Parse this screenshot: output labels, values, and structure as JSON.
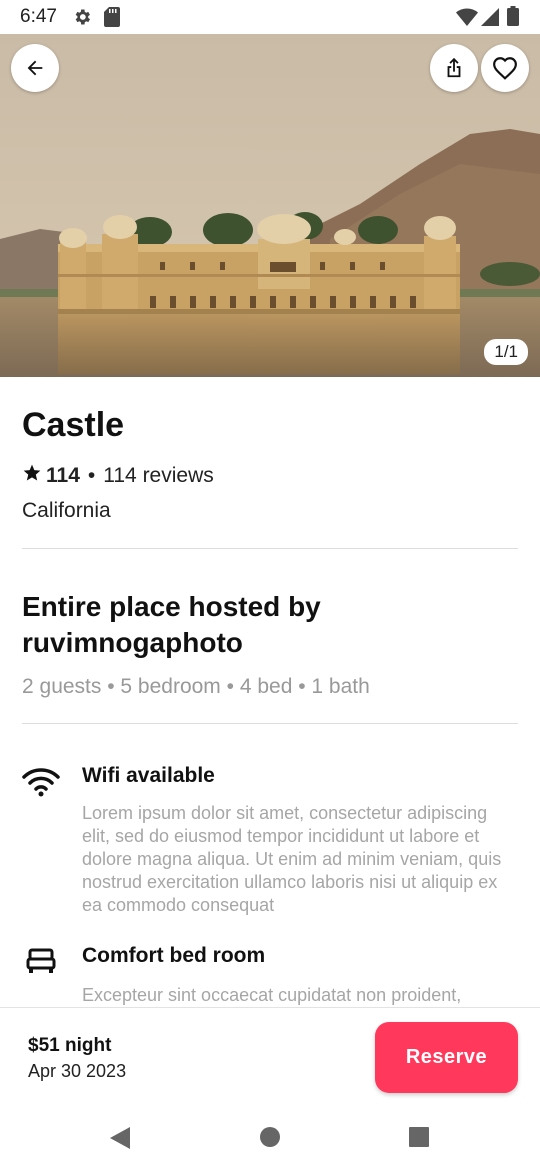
{
  "status_bar": {
    "time": "6:47",
    "icons": [
      "settings-icon",
      "sd-card-icon",
      "wifi-icon",
      "signal-icon",
      "battery-icon"
    ]
  },
  "hero": {
    "counter": "1/1",
    "buttons": [
      "back-arrow-icon",
      "share-icon",
      "heart-icon"
    ]
  },
  "listing": {
    "title": "Castle",
    "rating": "114",
    "reviews": "114 reviews",
    "location": "California"
  },
  "host": {
    "title": "Entire place hosted by ruvimnogaphoto",
    "summary": "2 guests • 5 bedroom • 4 bed • 1 bath"
  },
  "amenities": [
    {
      "icon": "wifi-icon",
      "title": "Wifi available",
      "description": "Lorem ipsum dolor sit amet, consectetur adipiscing elit, sed do eiusmod tempor incididunt ut labore et dolore magna aliqua. Ut enim ad minim veniam, quis nostrud exercitation ullamco laboris nisi ut aliquip ex ea commodo consequat"
    },
    {
      "icon": "bed-icon",
      "title": "Comfort bed room",
      "description": "Excepteur sint occaecat cupidatat non proident,"
    }
  ],
  "booking": {
    "price": "$51 night",
    "date": "Apr 30 2023",
    "reserve_label": "Reserve"
  },
  "colors": {
    "accent": "#ff385c",
    "muted_text": "#999999"
  },
  "nav_bar": [
    "back-triangle-icon",
    "home-circle-icon",
    "recents-square-icon"
  ]
}
